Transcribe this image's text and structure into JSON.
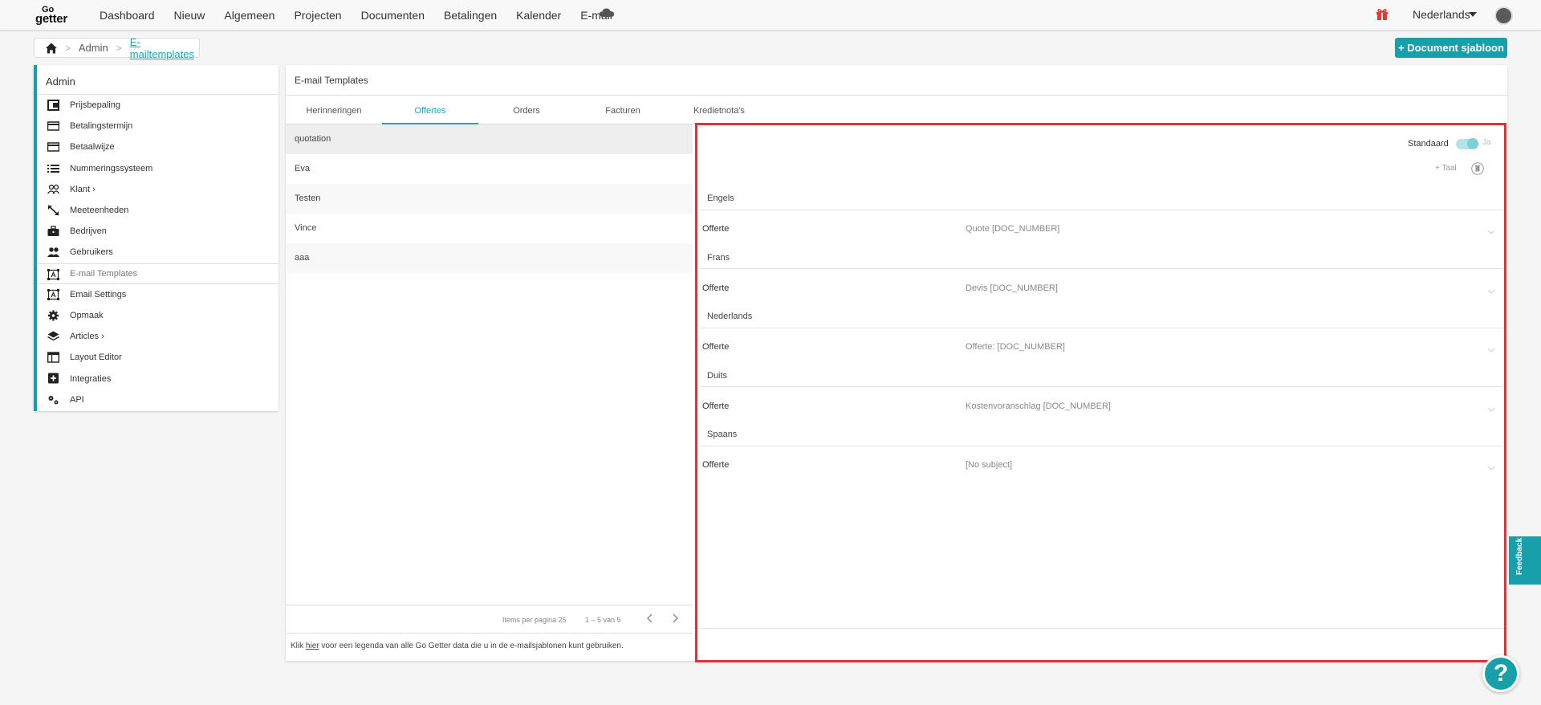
{
  "navbar": {
    "logo_top": "Go",
    "logo_bottom": "getter",
    "items": [
      "Dashboard",
      "Nieuw",
      "Algemeen",
      "Projecten",
      "Documenten",
      "Betalingen",
      "Kalender",
      "E-mail"
    ],
    "language": "Nederlands"
  },
  "breadcrumb": {
    "admin": "Admin",
    "current": "E-mailtemplates"
  },
  "actions": {
    "document_template": "+ Document sjabloon"
  },
  "sidebar": {
    "title": "Admin",
    "items": [
      {
        "label": "Prijsbepaling",
        "icon": "price-tag-icon"
      },
      {
        "label": "Betalingstermijn",
        "icon": "credit-card-icon"
      },
      {
        "label": "Betaalwijze",
        "icon": "credit-card-icon"
      },
      {
        "label": "Nummeringssysteem",
        "icon": "list-icon"
      },
      {
        "label": "Klant ›",
        "icon": "people-icon"
      },
      {
        "label": "Meeteenheden",
        "icon": "resize-icon"
      },
      {
        "label": "Bedrijven",
        "icon": "briefcase-icon"
      },
      {
        "label": "Gebruikers",
        "icon": "users-icon"
      },
      {
        "label": "E-mail Templates",
        "icon": "template-icon"
      },
      {
        "label": "Email Settings",
        "icon": "template-icon"
      },
      {
        "label": "Opmaak",
        "icon": "gear-icon"
      },
      {
        "label": "Articles ›",
        "icon": "layers-icon"
      },
      {
        "label": "Layout Editor",
        "icon": "layout-icon"
      },
      {
        "label": "Integraties",
        "icon": "plus-box-icon"
      },
      {
        "label": "API",
        "icon": "gears-icon"
      }
    ],
    "active_index": 8
  },
  "main": {
    "title": "E-mail Templates",
    "tabs": [
      "Herinneringen",
      "Offertes",
      "Orders",
      "Facturen",
      "Kredietnota's"
    ],
    "active_tab": 1,
    "list": [
      "quotation",
      "Eva",
      "Testen",
      "Vince",
      "aaa"
    ],
    "pager": {
      "items_per_page": "Items per pagina 25",
      "range": "1 – 5 van 5"
    },
    "footer": {
      "before": "Klik ",
      "link": "hier",
      "after": " voor een legenda van alle Go Getter data die u in de e-mailsjablonen kunt gebruiken."
    }
  },
  "detail": {
    "standard_label": "Standaard",
    "standard_value": "Ja",
    "standard_on": true,
    "add_language": "+ Taal",
    "languages": [
      {
        "name": "Engels",
        "label": "Offerte",
        "subject": "Quote [DOC_NUMBER]"
      },
      {
        "name": "Frans",
        "label": "Offerte",
        "subject": "Devis [DOC_NUMBER]"
      },
      {
        "name": "Nederlands",
        "label": "Offerte",
        "subject": "Offerte: [DOC_NUMBER]"
      },
      {
        "name": "Duits",
        "label": "Offerte",
        "subject": "Kostenvoranschlag [DOC_NUMBER]"
      },
      {
        "name": "Spaans",
        "label": "Offerte",
        "subject": "[No subject]"
      }
    ]
  },
  "widgets": {
    "feedback": "Feedback",
    "help": "?"
  },
  "colors": {
    "accent": "#17a0aa",
    "highlight": "#e0303a"
  }
}
